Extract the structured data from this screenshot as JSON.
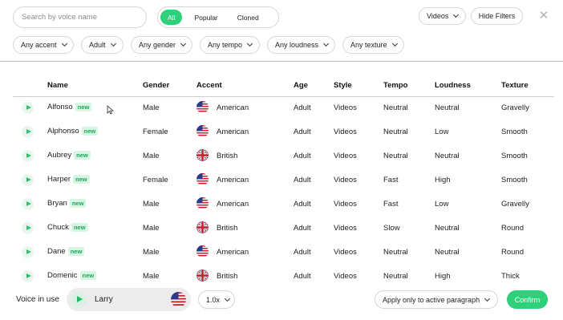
{
  "search": {
    "placeholder": "Search by voice name"
  },
  "segments": [
    "All",
    "Popular",
    "Cloned"
  ],
  "toolbar": {
    "videos": "Videos",
    "hide_filters": "Hide Filters",
    "close": "✕"
  },
  "filters": [
    "Any accent",
    "Adult",
    "Any gender",
    "Any tempo",
    "Any loudness",
    "Any texture"
  ],
  "columns": [
    "Name",
    "Gender",
    "Accent",
    "Age",
    "Style",
    "Tempo",
    "Loudness",
    "Texture"
  ],
  "badge_label": "new",
  "rows": [
    {
      "name": "Alfonso",
      "gender": "Male",
      "accent": "American",
      "flag": "us",
      "age": "Adult",
      "style": "Videos",
      "tempo": "Neutral",
      "loudness": "Neutral",
      "texture": "Gravelly"
    },
    {
      "name": "Alphonso",
      "gender": "Female",
      "accent": "American",
      "flag": "us",
      "age": "Adult",
      "style": "Videos",
      "tempo": "Neutral",
      "loudness": "Low",
      "texture": "Smooth"
    },
    {
      "name": "Aubrey",
      "gender": "Male",
      "accent": "British",
      "flag": "uk",
      "age": "Adult",
      "style": "Videos",
      "tempo": "Neutral",
      "loudness": "Neutral",
      "texture": "Smooth"
    },
    {
      "name": "Harper",
      "gender": "Female",
      "accent": "American",
      "flag": "us",
      "age": "Adult",
      "style": "Videos",
      "tempo": "Fast",
      "loudness": "High",
      "texture": "Smooth"
    },
    {
      "name": "Bryan",
      "gender": "Male",
      "accent": "American",
      "flag": "us",
      "age": "Adult",
      "style": "Videos",
      "tempo": "Fast",
      "loudness": "Low",
      "texture": "Gravelly"
    },
    {
      "name": "Chuck",
      "gender": "Male",
      "accent": "British",
      "flag": "uk",
      "age": "Adult",
      "style": "Videos",
      "tempo": "Slow",
      "loudness": "Neutral",
      "texture": "Round"
    },
    {
      "name": "Dane",
      "gender": "Male",
      "accent": "American",
      "flag": "us",
      "age": "Adult",
      "style": "Videos",
      "tempo": "Neutral",
      "loudness": "Neutral",
      "texture": "Round"
    },
    {
      "name": "Domenic",
      "gender": "Male",
      "accent": "British",
      "flag": "uk",
      "age": "Adult",
      "style": "Videos",
      "tempo": "Neutral",
      "loudness": "High",
      "texture": "Thick"
    }
  ],
  "footer": {
    "voice_in_use_label": "Voice in use",
    "current_voice": "Larry",
    "current_flag": "us",
    "speed": "1.0x",
    "apply": "Apply only to active paragraph",
    "confirm": "Confirm"
  },
  "colors": {
    "accent": "#2fd07a",
    "badge_bg": "#d8f5e3",
    "badge_text": "#18a957"
  }
}
